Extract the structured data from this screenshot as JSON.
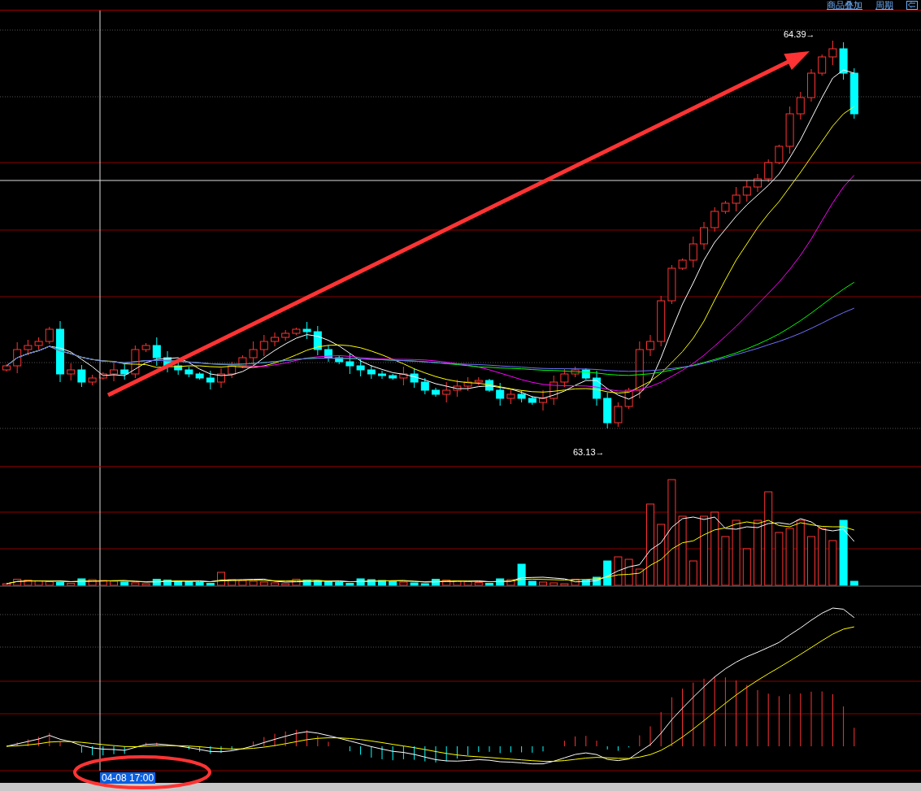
{
  "toolbar": {
    "links": [
      "商品叠加",
      "周期"
    ]
  },
  "price_chart": {
    "high_label": "64.39→",
    "low_label": "63.13→"
  },
  "crosshair": {
    "time_label": "04-08 17:00"
  }
}
